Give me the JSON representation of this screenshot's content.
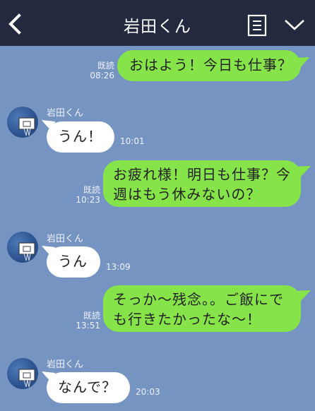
{
  "header": {
    "title": "岩田くん"
  },
  "messages": [
    {
      "text": "おはよう！今日も仕事？",
      "read": "既読",
      "time": "08:26"
    },
    {
      "sender": "岩田くん",
      "text": "うん！",
      "time": "10:01"
    },
    {
      "line1": "お疲れ様！明日も仕事？今",
      "line2": "週はもう休みないの？",
      "read": "既読",
      "time": "10:23"
    },
    {
      "sender": "岩田くん",
      "text": "うん",
      "time": "13:09"
    },
    {
      "line1": "そっか〜残念。。ご飯にで",
      "line2": "も行きたかったな〜！",
      "read": "既読",
      "time": "13:51"
    },
    {
      "sender": "岩田くん",
      "text": "なんで？",
      "time": "20:03"
    }
  ],
  "colors": {
    "background": "#7694c1",
    "header": "#232a3f",
    "outgoing_bubble": "#87e34a",
    "incoming_bubble": "#ffffff"
  },
  "icons": {
    "back": "chevron-left-icon",
    "notes": "notes-icon",
    "menu": "chevron-down-icon",
    "avatar": "basketball-hoop-avatar"
  }
}
